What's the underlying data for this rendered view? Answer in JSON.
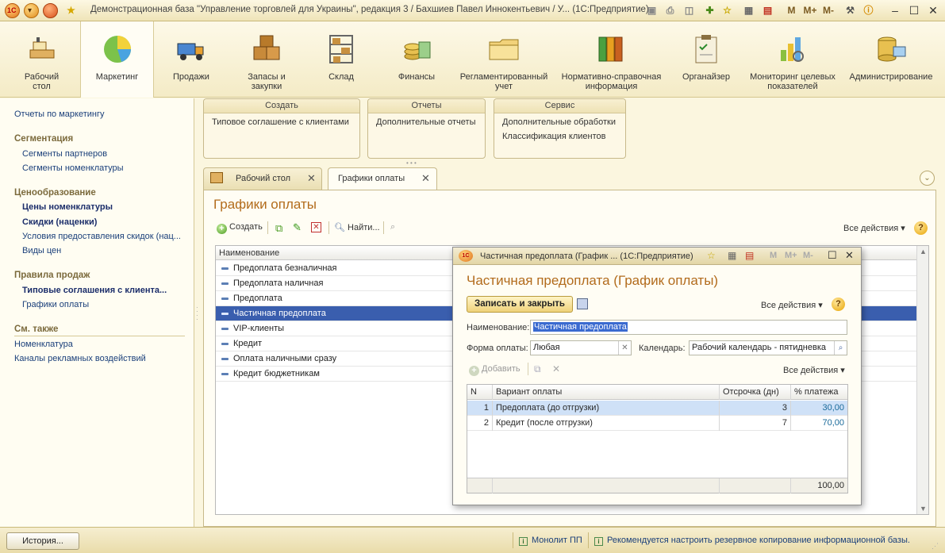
{
  "window": {
    "title": "Демонстрационная база \"Управление торговлей для Украины\", редакция 3 / Бахшиев Павел Иннокентьевич / У...  (1С:Предприятие)",
    "m_labels": [
      "M",
      "M+",
      "M-"
    ]
  },
  "sections": [
    {
      "label": "Рабочий стол",
      "icon": "desk-icon"
    },
    {
      "label": "Маркетинг",
      "icon": "pie-chart-icon"
    },
    {
      "label": "Продажи",
      "icon": "truck-icon"
    },
    {
      "label": "Запасы и закупки",
      "icon": "boxes-icon"
    },
    {
      "label": "Склад",
      "icon": "warehouse-shelf-icon"
    },
    {
      "label": "Финансы",
      "icon": "coins-icon"
    },
    {
      "label": "Регламентированный учет",
      "icon": "folder-icon"
    },
    {
      "label": "Нормативно-справочная информация",
      "icon": "binders-icon"
    },
    {
      "label": "Органайзер",
      "icon": "clipboard-icon"
    },
    {
      "label": "Мониторинг целевых показателей",
      "icon": "bar-chart-icon"
    },
    {
      "label": "Администрирование",
      "icon": "database-icon"
    }
  ],
  "leftnav": {
    "top_link": "Отчеты по маркетингу",
    "groups": [
      {
        "head": "Сегментация",
        "items": [
          "Сегменты партнеров",
          "Сегменты номенклатуры"
        ]
      },
      {
        "head": "Ценообразование",
        "items": [
          "Цены номенклатуры",
          "Скидки (наценки)",
          "Условия предоставления скидок (нац...",
          "Виды цен"
        ]
      },
      {
        "head": "Правила продаж",
        "items": [
          "Типовые соглашения с клиента...",
          "Графики оплаты"
        ]
      },
      {
        "head": "См. также",
        "items": [
          "Номенклатура",
          "Каналы рекламных воздействий"
        ]
      }
    ]
  },
  "command_groups": [
    {
      "head": "Создать",
      "items": [
        "Типовое соглашение с клиентами"
      ]
    },
    {
      "head": "Отчеты",
      "items": [
        "Дополнительные отчеты"
      ]
    },
    {
      "head": "Сервис",
      "items": [
        "Дополнительные обработки",
        "Классификация клиентов"
      ]
    }
  ],
  "tabs": [
    {
      "label": "Рабочий стол"
    },
    {
      "label": "Графики оплаты"
    }
  ],
  "list_form": {
    "title": "Графики оплаты",
    "create_label": "Создать",
    "find_label": "Найти...",
    "all_actions": "Все действия",
    "column_name": "Наименование",
    "rows": [
      "Предоплата безналичная",
      "Предоплата наличная",
      "Предоплата",
      "Частичная предоплата",
      "VIP-клиенты",
      "Кредит",
      "Оплата наличными сразу",
      "Кредит бюджетникам"
    ],
    "selected_row": "Частичная предоплата"
  },
  "dialog": {
    "window_title": "Частичная предоплата (График ...  (1С:Предприятие)",
    "heading": "Частичная предоплата (График оплаты)",
    "save_close": "Записать и закрыть",
    "all_actions": "Все действия",
    "name_label": "Наименование:",
    "name_value": "Частичная предоплата",
    "payment_form_label": "Форма оплаты:",
    "payment_form_value": "Любая",
    "calendar_label": "Календарь:",
    "calendar_value": "Рабочий календарь - пятидневка",
    "add_label": "Добавить",
    "table_all_actions": "Все действия",
    "columns": {
      "n": "N",
      "variant": "Вариант оплаты",
      "delay": "Отсрочка (дн)",
      "percent": "% платежа"
    },
    "rows": [
      {
        "n": "1",
        "variant": "Предоплата (до отгрузки)",
        "delay": "3",
        "percent": "30,00"
      },
      {
        "n": "2",
        "variant": "Кредит (после отгрузки)",
        "delay": "7",
        "percent": "70,00"
      }
    ],
    "total_percent": "100,00"
  },
  "statusbar": {
    "history": "История...",
    "user_link": "Монолит ПП",
    "message": "Рекомендуется настроить резервное копирование информационной базы."
  },
  "colors": {
    "accent_title": "#b26b1c",
    "selection": "#3a5eae",
    "link": "#1a3f7a"
  }
}
